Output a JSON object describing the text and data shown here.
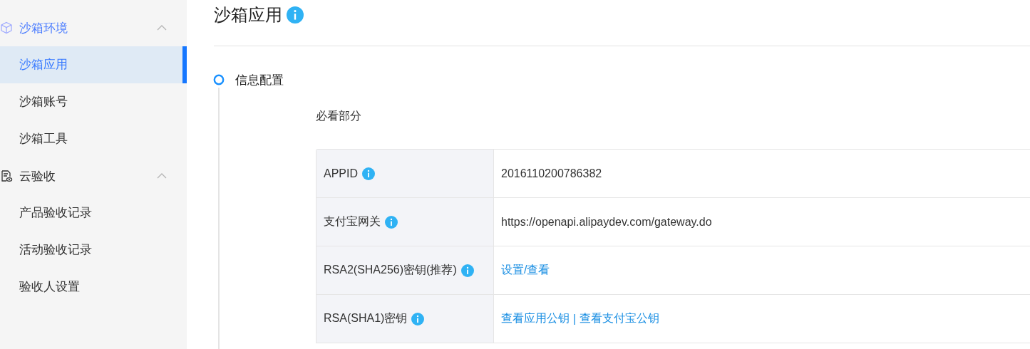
{
  "sidebar": {
    "groups": [
      {
        "label": "沙箱环境",
        "kind": "cube",
        "active": true,
        "expanded": true,
        "items": [
          {
            "label": "沙箱应用",
            "selected": true
          },
          {
            "label": "沙箱账号",
            "selected": false
          },
          {
            "label": "沙箱工具",
            "selected": false
          }
        ]
      },
      {
        "label": "云验收",
        "kind": "document",
        "active": false,
        "expanded": true,
        "items": [
          {
            "label": "产品验收记录",
            "selected": false
          },
          {
            "label": "活动验收记录",
            "selected": false
          },
          {
            "label": "验收人设置",
            "selected": false
          }
        ]
      }
    ]
  },
  "page": {
    "title": "沙箱应用",
    "step": {
      "label": "信息配置"
    },
    "section_title": "必看部分",
    "table": {
      "rows": [
        {
          "label": "APPID",
          "value": [
            {
              "kind": "text",
              "text": "2016110200786382"
            }
          ]
        },
        {
          "label": "支付宝网关",
          "value": [
            {
              "kind": "text",
              "text": "https://openapi.alipaydev.com/gateway.do"
            }
          ]
        },
        {
          "label": "RSA2(SHA256)密钥(推荐)",
          "value": [
            {
              "kind": "link",
              "text": "设置/查看"
            }
          ]
        },
        {
          "label": "RSA(SHA1)密钥",
          "value": [
            {
              "kind": "link",
              "text": "查看应用公钥"
            },
            {
              "kind": "separator",
              "text": "|"
            },
            {
              "kind": "link",
              "text": "查看支付宝公钥"
            }
          ]
        }
      ]
    }
  }
}
